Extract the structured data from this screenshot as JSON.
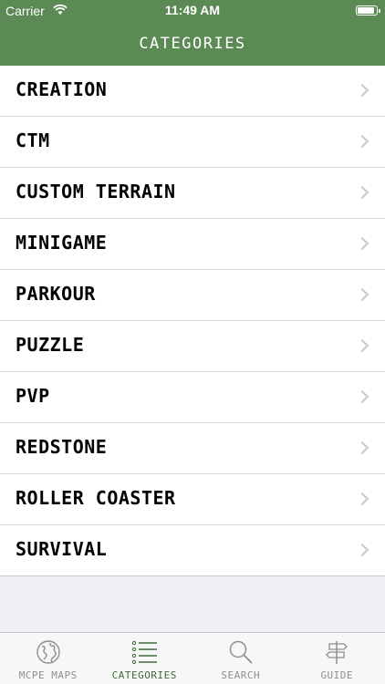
{
  "status_bar": {
    "carrier": "Carrier",
    "time": "11:49 AM",
    "battery_level": 0.92
  },
  "nav": {
    "title": "CATEGORIES"
  },
  "categories": [
    {
      "label": "CREATION"
    },
    {
      "label": "CTM"
    },
    {
      "label": "CUSTOM TERRAIN"
    },
    {
      "label": "MINIGAME"
    },
    {
      "label": "PARKOUR"
    },
    {
      "label": "PUZZLE"
    },
    {
      "label": "PVP"
    },
    {
      "label": "REDSTONE"
    },
    {
      "label": "ROLLER COASTER"
    },
    {
      "label": "SURVIVAL"
    }
  ],
  "tabbar": {
    "tabs": [
      {
        "label": "MCPE MAPS",
        "icon": "globe-icon"
      },
      {
        "label": "CATEGORIES",
        "icon": "list-icon"
      },
      {
        "label": "SEARCH",
        "icon": "search-icon"
      },
      {
        "label": "GUIDE",
        "icon": "signpost-icon"
      }
    ],
    "active_index": 1
  },
  "colors": {
    "nav_bg": "#5c8a55",
    "active_tab": "#3f6b3a",
    "inactive_tab": "#8e8e93"
  }
}
